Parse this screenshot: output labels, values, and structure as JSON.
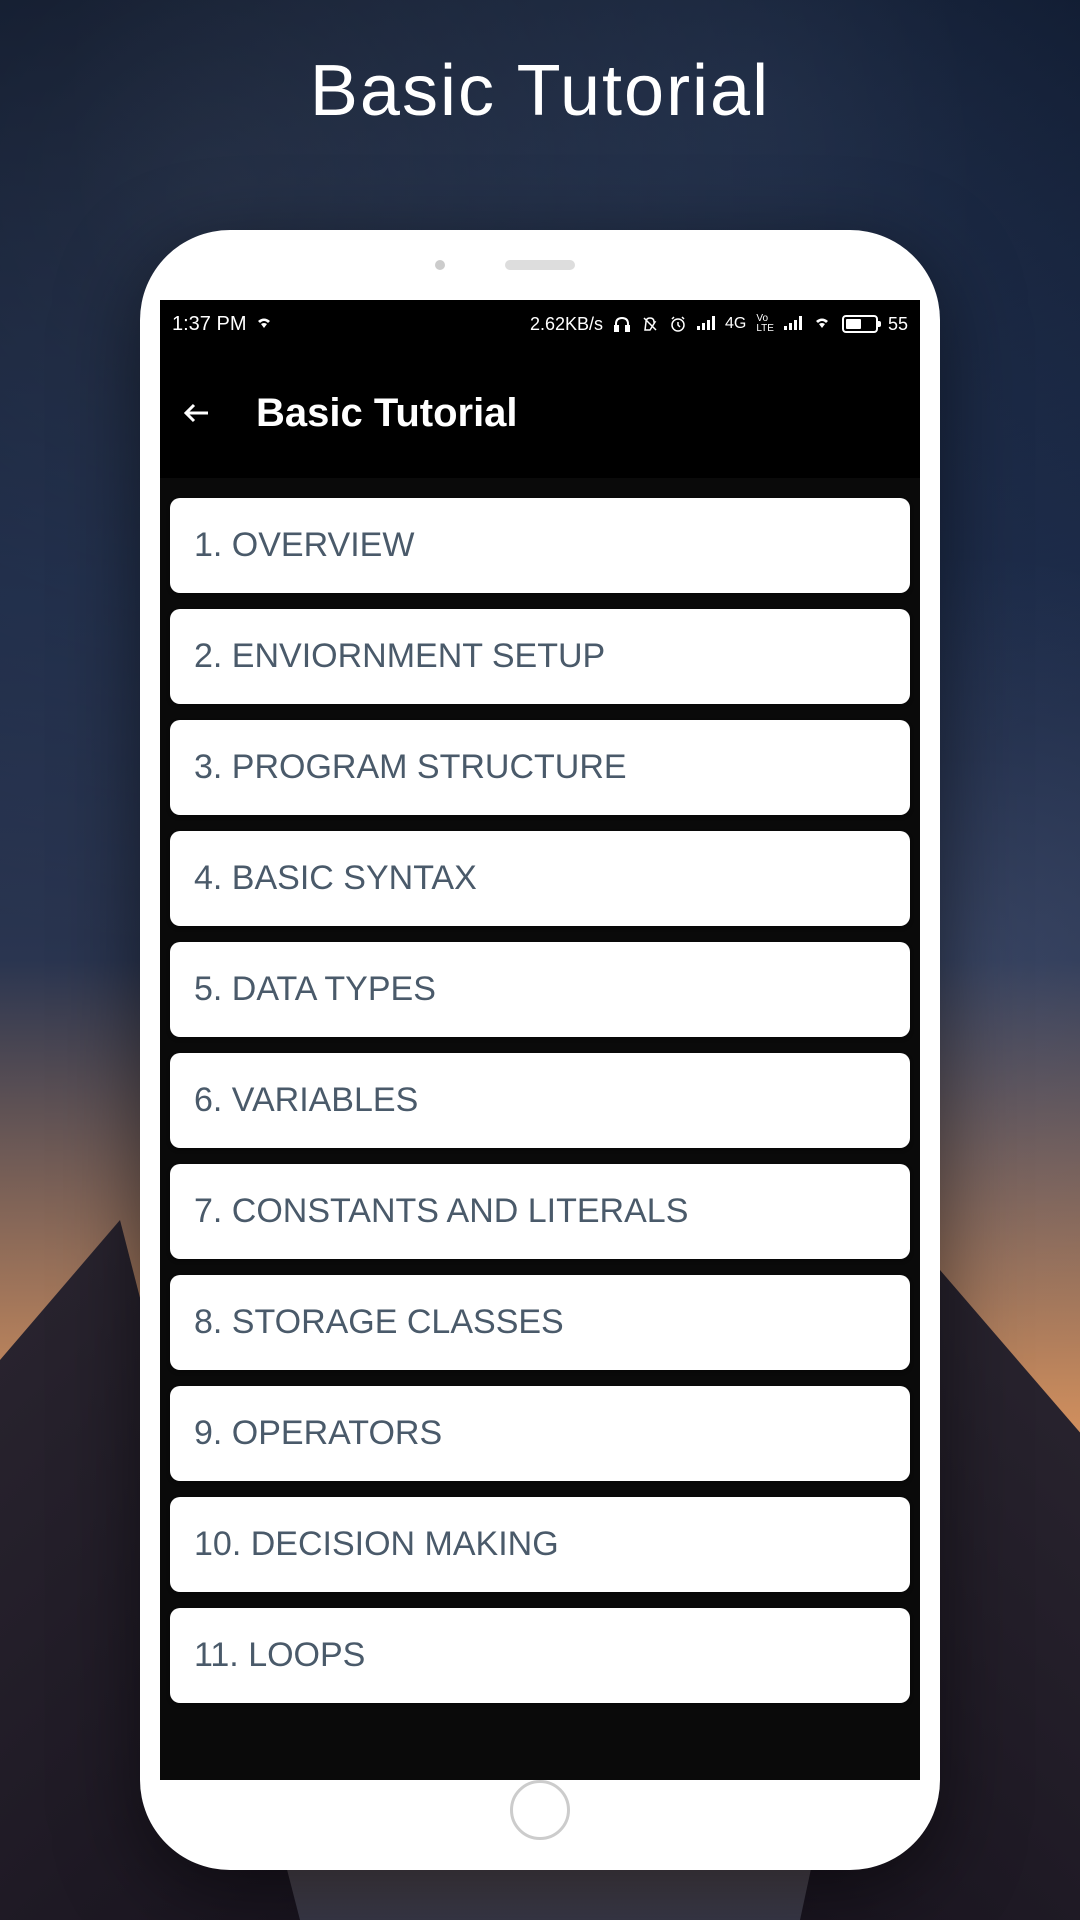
{
  "page": {
    "title": "Basic Tutorial"
  },
  "statusBar": {
    "time": "1:37 PM",
    "dataSpeed": "2.62KB/s",
    "network": "4G",
    "volte": "VoLTE",
    "battery": "55"
  },
  "app": {
    "headerTitle": "Basic Tutorial"
  },
  "tutorialItems": [
    {
      "label": "1. OVERVIEW"
    },
    {
      "label": "2. ENVIORNMENT SETUP"
    },
    {
      "label": "3. PROGRAM STRUCTURE"
    },
    {
      "label": "4. BASIC SYNTAX"
    },
    {
      "label": "5. DATA TYPES"
    },
    {
      "label": "6. VARIABLES"
    },
    {
      "label": "7. CONSTANTS AND LITERALS"
    },
    {
      "label": "8. STORAGE CLASSES"
    },
    {
      "label": "9. OPERATORS"
    },
    {
      "label": "10. DECISION MAKING"
    },
    {
      "label": "11. LOOPS"
    }
  ]
}
